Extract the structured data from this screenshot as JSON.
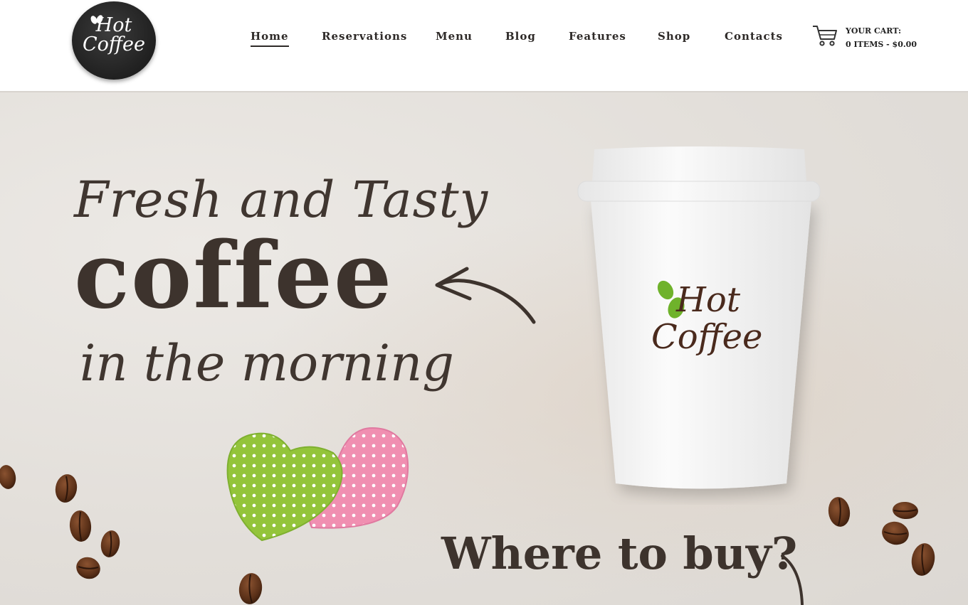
{
  "logo": {
    "line1": "Hot",
    "line2": "Coffee"
  },
  "nav": {
    "items": [
      {
        "label": "Home",
        "active": true
      },
      {
        "label": "Reservations"
      },
      {
        "label": "Menu"
      },
      {
        "label": "Blog"
      },
      {
        "label": "Features"
      },
      {
        "label": "Shop"
      },
      {
        "label": "Contacts"
      }
    ]
  },
  "cart": {
    "title": "YOUR CART:",
    "summary": "0 ITEMS - $0.00",
    "icon": "shopping-cart-icon"
  },
  "hero": {
    "line1": "Fresh and Tasty",
    "line2": "coffee",
    "line3": "in the morning",
    "cup_logo_line1": "Hot",
    "cup_logo_line2": "Coffee",
    "where_to_buy": "Where to buy?"
  },
  "colors": {
    "text_dark": "#3d332d",
    "background": "#e2ded9",
    "accent_green": "#6fb22b",
    "accent_brown": "#4a2a1d"
  }
}
